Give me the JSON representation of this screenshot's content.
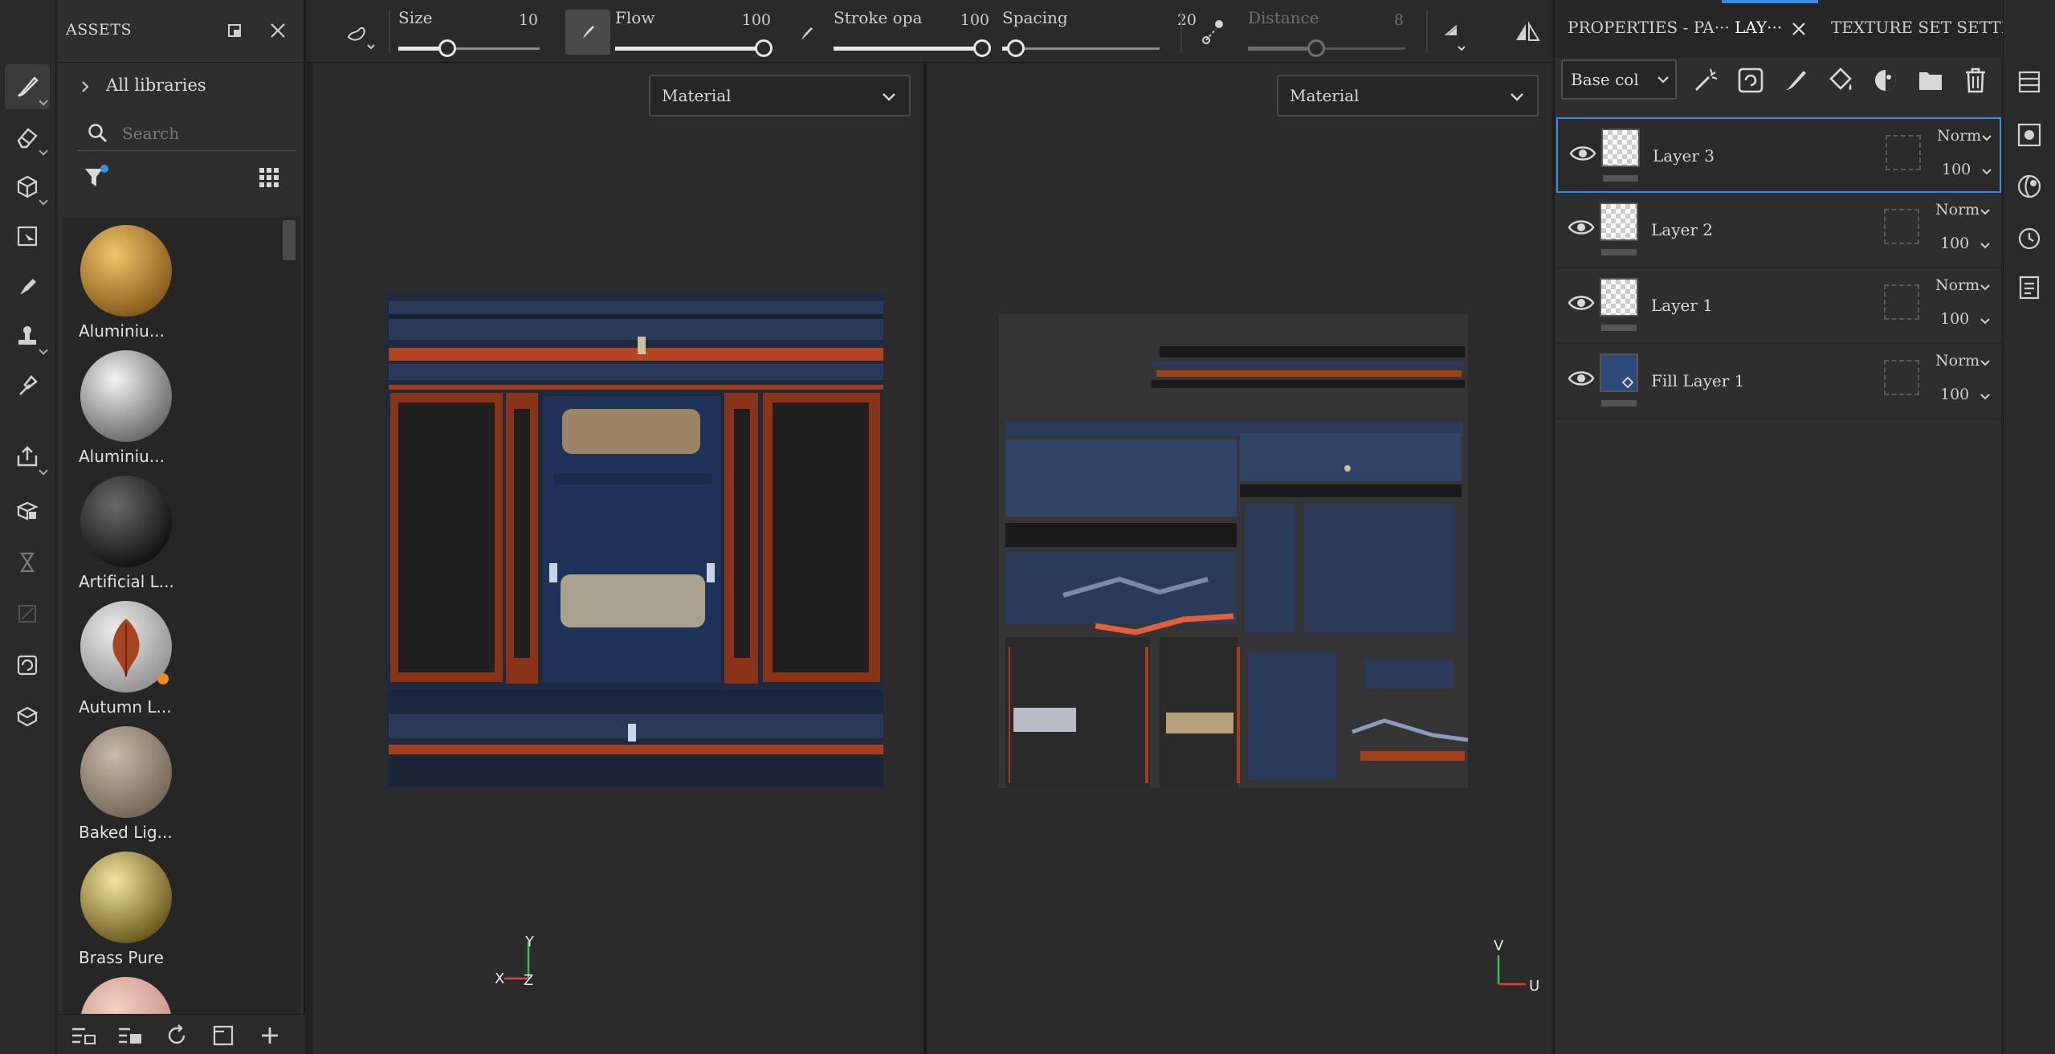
{
  "assets_panel": {
    "title": "ASSETS",
    "libraries_label": "All libraries",
    "search_placeholder": "Search",
    "items": [
      {
        "label": "Aluminiu...",
        "color_a": "#f2c46a",
        "color_b": "#7a4f12"
      },
      {
        "label": "Aluminiu...",
        "color_a": "#f4f4f4",
        "color_b": "#5a5a5a"
      },
      {
        "label": "Artificial L...",
        "color_a": "#6a6a6a",
        "color_b": "#080808"
      },
      {
        "label": "Autumn L...",
        "color_a": "#ececec",
        "color_b": "#8a8a8a"
      },
      {
        "label": "Baked Lig...",
        "color_a": "#c8baa8",
        "color_b": "#6a5e50"
      },
      {
        "label": "Brass Pure",
        "color_a": "#f4e6a0",
        "color_b": "#5a4a10"
      }
    ]
  },
  "toolbar": {
    "size_label": "Size",
    "size_value": "10",
    "flow_label": "Flow",
    "flow_value": "100",
    "stroke_label": "Stroke opa",
    "stroke_value": "100",
    "spacing_label": "Spacing",
    "spacing_value": "20",
    "distance_label": "Distance",
    "distance_value": "8"
  },
  "viewport_3d": {
    "mode": "Material",
    "axis_y": "Y",
    "axis_x": "X",
    "axis_z": "Z"
  },
  "viewport_2d": {
    "mode": "Material",
    "axis_v": "V",
    "axis_u": "U"
  },
  "layers_panel": {
    "tabs": [
      "PROPERTIES - PA···",
      "LAY···",
      "TEXTURE SET SETTI···"
    ],
    "channel": "Base col",
    "layers": [
      {
        "name": "Layer 3",
        "blend": "Norm",
        "opacity": "100",
        "selected": true,
        "type": "paint"
      },
      {
        "name": "Layer 2",
        "blend": "Norm",
        "opacity": "100",
        "selected": false,
        "type": "paint"
      },
      {
        "name": "Layer 1",
        "blend": "Norm",
        "opacity": "100",
        "selected": false,
        "type": "paint"
      },
      {
        "name": "Fill Layer 1",
        "blend": "Norm",
        "opacity": "100",
        "selected": false,
        "type": "fill"
      }
    ]
  },
  "colors": {
    "accent": "#3a8ee6",
    "panel_bg": "#2e2e2e",
    "viewport_bg": "#2b2b2b"
  }
}
